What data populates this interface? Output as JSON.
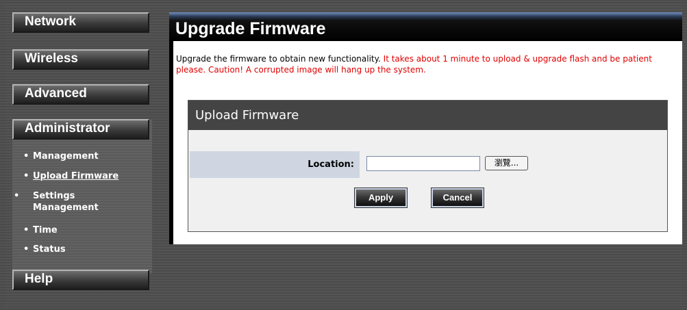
{
  "sidebar": {
    "menus": [
      {
        "label": "Network"
      },
      {
        "label": "Wireless"
      },
      {
        "label": "Advanced"
      },
      {
        "label": "Administrator"
      },
      {
        "label": "Help"
      }
    ],
    "submenu": [
      {
        "label": "Management"
      },
      {
        "label": "Upload Firmware"
      },
      {
        "label": "Settings Management"
      },
      {
        "label": "Time"
      },
      {
        "label": "Status"
      }
    ],
    "bullet": "•"
  },
  "main": {
    "title": "Upgrade Firmware",
    "description": "Upgrade the firmware to obtain new functionality.",
    "warning": "It takes about 1 minute to upload & upgrade flash and be patient please. Caution! A corrupted image will hang up the system.",
    "box_title": "Upload Firmware",
    "location_label": "Location:",
    "location_value": "",
    "browse_label": "瀏覽...",
    "apply_label": "Apply",
    "cancel_label": "Cancel"
  },
  "colors": {
    "warning": "#e00000",
    "label_bg": "#cfd6e2",
    "box_header": "#444444"
  }
}
